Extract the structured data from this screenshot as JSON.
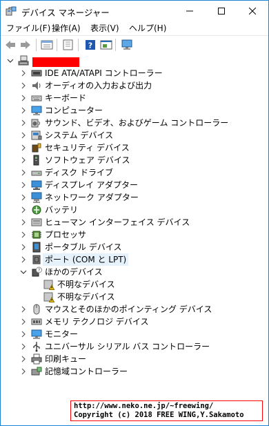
{
  "window": {
    "title": "デバイス マネージャー"
  },
  "menu": [
    {
      "label": "ファイル(F)"
    },
    {
      "label": "操作(A)"
    },
    {
      "label": "表示(V)"
    },
    {
      "label": "ヘルプ(H)"
    }
  ],
  "toolbar": {
    "icons": [
      "back-arrow-icon",
      "forward-arrow-icon",
      "properties-icon",
      "update-icon",
      "help-icon",
      "device-view-icon",
      "monitor-scan-icon"
    ]
  },
  "tree": {
    "root": {
      "label": ""
    },
    "categories": [
      {
        "label": "IDE ATA/ATAPI コントローラー",
        "icon": "ide-controller-icon"
      },
      {
        "label": "オーディオの入力および出力",
        "icon": "speaker-icon"
      },
      {
        "label": "キーボード",
        "icon": "keyboard-icon"
      },
      {
        "label": "コンピューター",
        "icon": "computer-icon"
      },
      {
        "label": "サウンド、ビデオ、およびゲーム コントローラー",
        "icon": "sound-icon"
      },
      {
        "label": "システム デバイス",
        "icon": "system-device-icon"
      },
      {
        "label": "セキュリティ デバイス",
        "icon": "security-device-icon"
      },
      {
        "label": "ソフトウェア デバイス",
        "icon": "software-device-icon"
      },
      {
        "label": "ディスク ドライブ",
        "icon": "disk-drive-icon"
      },
      {
        "label": "ディスプレイ アダプター",
        "icon": "display-adapter-icon"
      },
      {
        "label": "ネットワーク アダプター",
        "icon": "network-adapter-icon"
      },
      {
        "label": "バッテリ",
        "icon": "battery-icon"
      },
      {
        "label": "ヒューマン インターフェイス デバイス",
        "icon": "hid-icon"
      },
      {
        "label": "プロセッサ",
        "icon": "processor-icon"
      },
      {
        "label": "ポータブル デバイス",
        "icon": "portable-device-icon"
      },
      {
        "label": "ポート (COM と LPT)",
        "icon": "port-icon"
      },
      {
        "label": "ほかのデバイス",
        "icon": "other-device-icon"
      },
      {
        "label": "不明なデバイス",
        "icon": "unknown-device-warning-icon"
      },
      {
        "label": "不明なデバイス",
        "icon": "unknown-device-warning-icon"
      },
      {
        "label": "マウスとそのほかのポインティング デバイス",
        "icon": "mouse-icon"
      },
      {
        "label": "メモリ テクノロジ デバイス",
        "icon": "memory-device-icon"
      },
      {
        "label": "モニター",
        "icon": "monitor-icon"
      },
      {
        "label": "ユニバーサル シリアル バス コントローラー",
        "icon": "usb-controller-icon"
      },
      {
        "label": "印刷キュー",
        "icon": "printer-icon"
      },
      {
        "label": "記憶域コントローラー",
        "icon": "storage-controller-icon"
      }
    ]
  },
  "watermark": {
    "line1": "http://www.neko.ne.jp/~freewing/",
    "line2": "Copyright (c) 2018 FREE WING,Y.Sakamoto"
  },
  "colors": {
    "window_border": "#1883d7",
    "selection": "#e5f1fb",
    "redacted": "#ff0000"
  }
}
